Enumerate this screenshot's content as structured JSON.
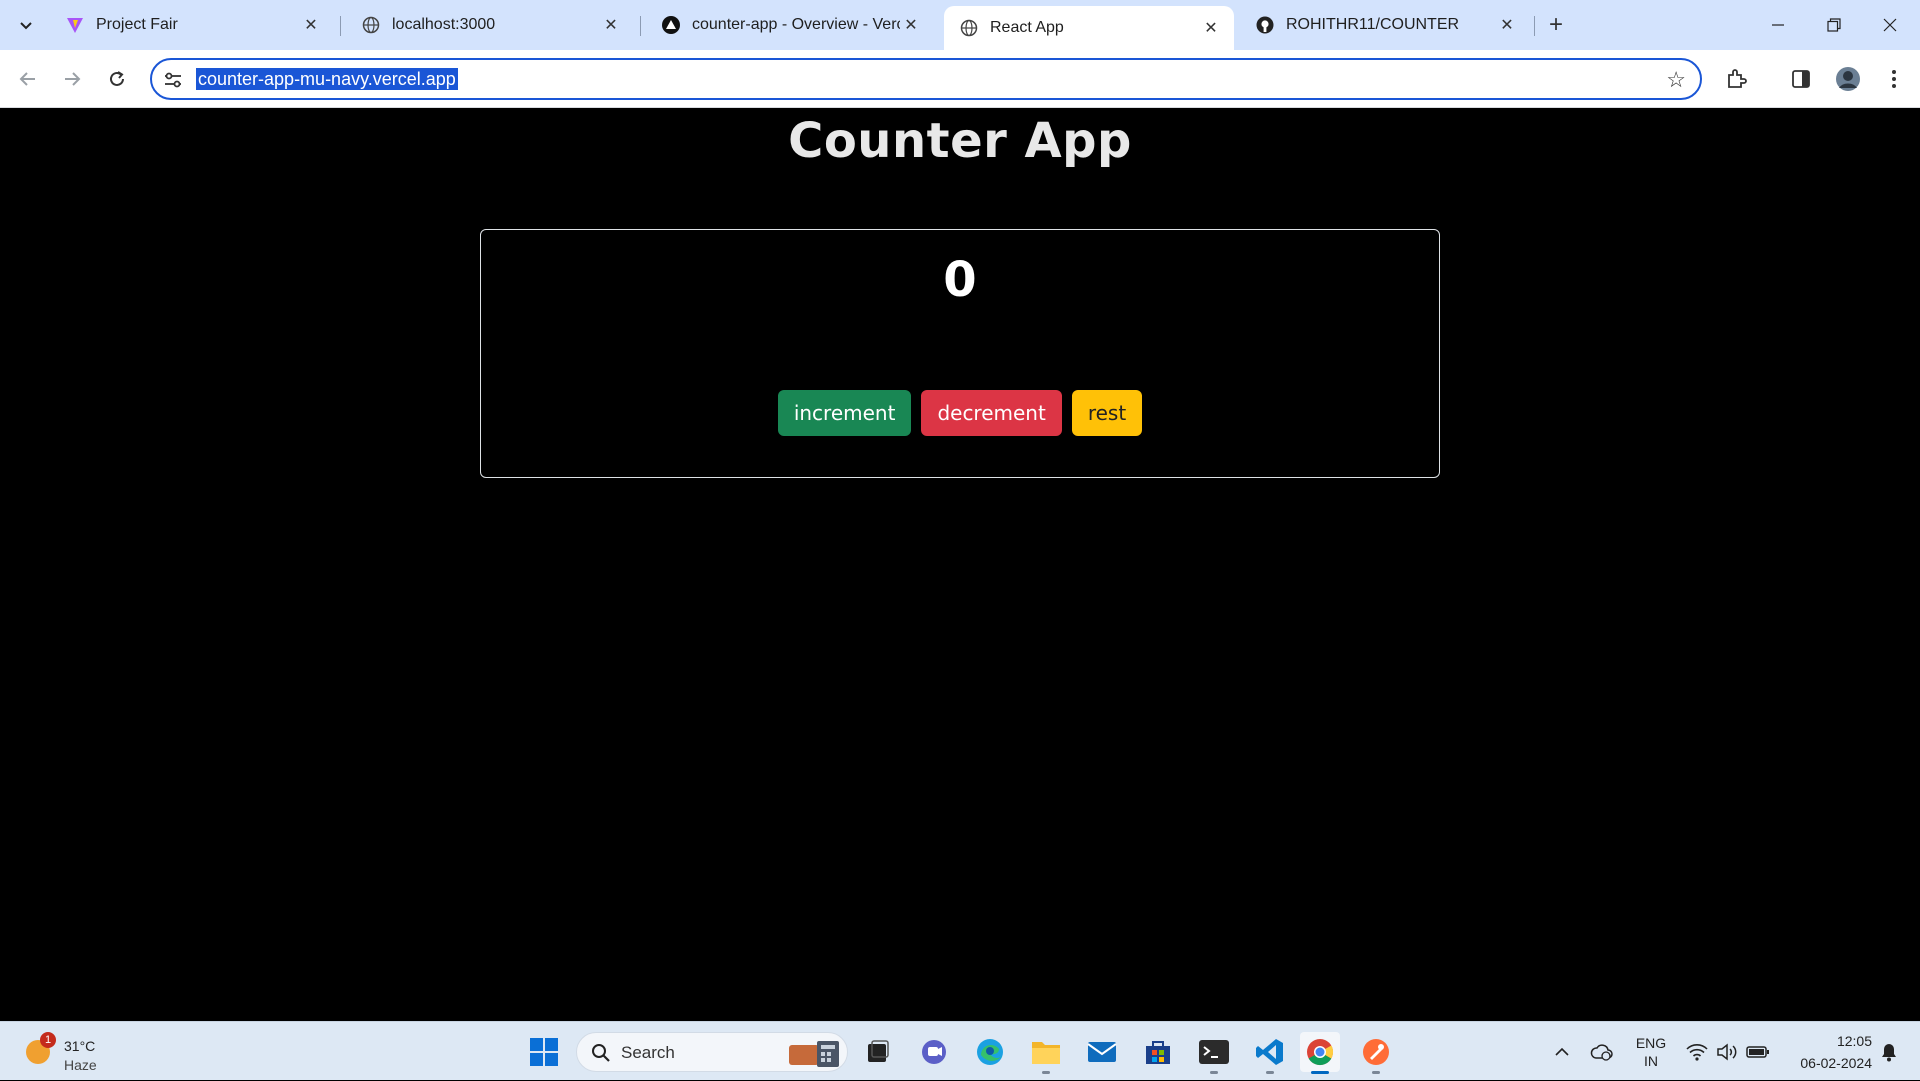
{
  "browser": {
    "tabs": [
      {
        "title": "Project Fair",
        "active": false
      },
      {
        "title": "localhost:3000",
        "active": false
      },
      {
        "title": "counter-app - Overview - Vercel",
        "active": false
      },
      {
        "title": "React App",
        "active": true
      },
      {
        "title": "ROHITHR11/COUNTER",
        "active": false
      }
    ],
    "url": "counter-app-mu-navy.vercel.app"
  },
  "page": {
    "title": "Counter App",
    "count": "0",
    "buttons": {
      "increment": "increment",
      "decrement": "decrement",
      "reset": "rest"
    },
    "colors": {
      "increment": "#198754",
      "decrement": "#dc3545",
      "reset": "#ffc107"
    }
  },
  "taskbar": {
    "weather": {
      "temp": "31°C",
      "condition": "Haze",
      "badge": "1"
    },
    "search_label": "Search",
    "apps": [
      "widgets-app",
      "task-view",
      "teams",
      "edge",
      "file-explorer",
      "mail",
      "store",
      "terminal",
      "vscode",
      "chrome",
      "postman"
    ],
    "language": {
      "line1": "ENG",
      "line2": "IN"
    },
    "time": "12:05",
    "date": "06-02-2024"
  }
}
